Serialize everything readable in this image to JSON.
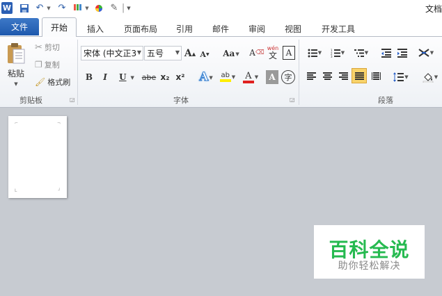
{
  "window": {
    "title": "文档"
  },
  "tabs": {
    "file": "文件",
    "home": "开始",
    "items": [
      "插入",
      "页面布局",
      "引用",
      "邮件",
      "审阅",
      "视图",
      "开发工具"
    ]
  },
  "clipboard": {
    "paste": "粘贴",
    "cut": "剪切",
    "copy": "复制",
    "format_painter": "格式刷",
    "group_label": "剪贴板"
  },
  "font": {
    "font_name": "宋体 (中文正3",
    "font_size": "五号",
    "grow": "A",
    "shrink": "A",
    "change_case": "Aa",
    "clear_format": "A",
    "phonetic": "wén",
    "phonetic_char": "文",
    "char_border": "A",
    "bold": "B",
    "italic": "I",
    "underline": "U",
    "strike": "abe",
    "subscript": "x₂",
    "superscript": "x²",
    "text_effect": "A",
    "highlight": "ab",
    "font_color": "A",
    "char_shading": "A",
    "enclose": "字",
    "group_label": "字体"
  },
  "paragraph": {
    "group_label": "段落"
  },
  "watermark": {
    "title": "百科全说",
    "subtitle": "助你轻松解决"
  },
  "colors": {
    "file_tab": "#2b66b8",
    "watermark_green": "#26ba50",
    "font_color_red": "#e02020",
    "highlight_yellow": "#ffee00",
    "justify_active": "#f8d36a"
  }
}
